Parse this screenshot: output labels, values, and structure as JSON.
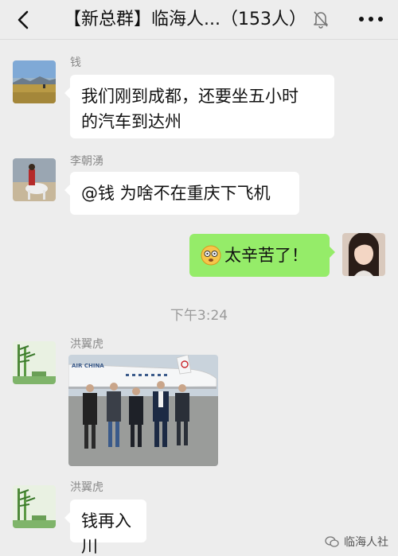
{
  "header": {
    "title": "【新总群】临海人...（153人）",
    "back_icon": "chevron-left-icon",
    "mute_icon": "bell-muted-icon",
    "more_icon": "ellipsis-icon"
  },
  "messages": [
    {
      "sender": "钱",
      "text_lines": [
        "我们刚到成都，还要坐五小时",
        "的汽车到达州"
      ]
    },
    {
      "sender": "李朝湧",
      "text": "@钱 为啥不在重庆下飞机"
    },
    {
      "text": "太辛苦了！",
      "emoji": "dizzy-face-emoji"
    },
    {
      "sender": "洪翼虎",
      "photo_caption": "AIR CHINA"
    },
    {
      "sender": "洪翼虎",
      "text": "钱再入川"
    }
  ],
  "time_separator": "下午3:24",
  "watermark": {
    "text": "临海人社",
    "icon": "wechat-channel-icon"
  },
  "colors": {
    "background": "#ededed",
    "bubble_self": "#95ec69",
    "bubble_other": "#ffffff"
  }
}
